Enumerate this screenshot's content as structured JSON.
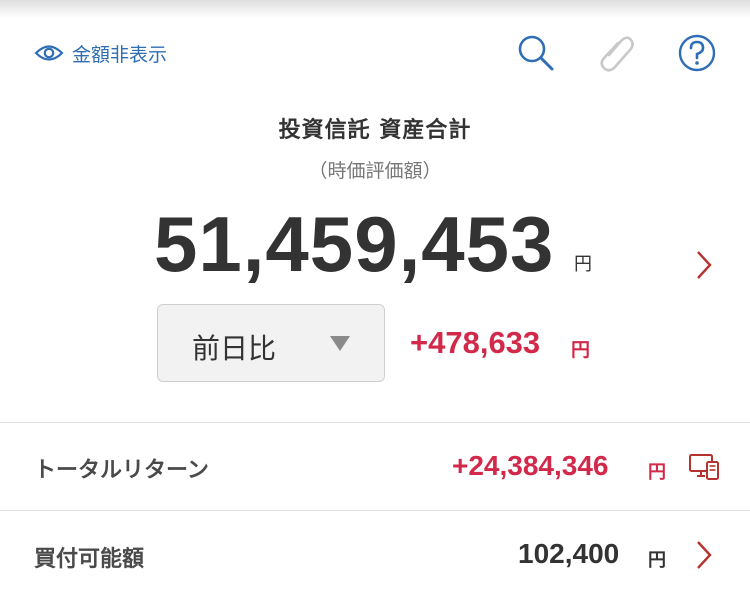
{
  "toolbar": {
    "hide_amount_label": "金額非表示",
    "icons": [
      "eye-icon",
      "search-icon",
      "paperclip-icon",
      "help-icon"
    ]
  },
  "summary": {
    "title": "投資信託 資産合計",
    "subtitle": "（時価評価額）",
    "total_value": "51,459,453",
    "total_unit": "円"
  },
  "comparison": {
    "selected_option": "前日比",
    "change_value": "+478,633",
    "change_unit": "円"
  },
  "rows": {
    "total_return": {
      "label": "トータルリターン",
      "value": "+24,384,346",
      "unit": "円"
    },
    "purchasable": {
      "label": "買付可能額",
      "value": "102,400",
      "unit": "円"
    }
  },
  "colors": {
    "accent_blue": "#2f6db5",
    "positive_red": "#d2294a",
    "chevron_red": "#b5332f",
    "text_dark": "#333333"
  }
}
